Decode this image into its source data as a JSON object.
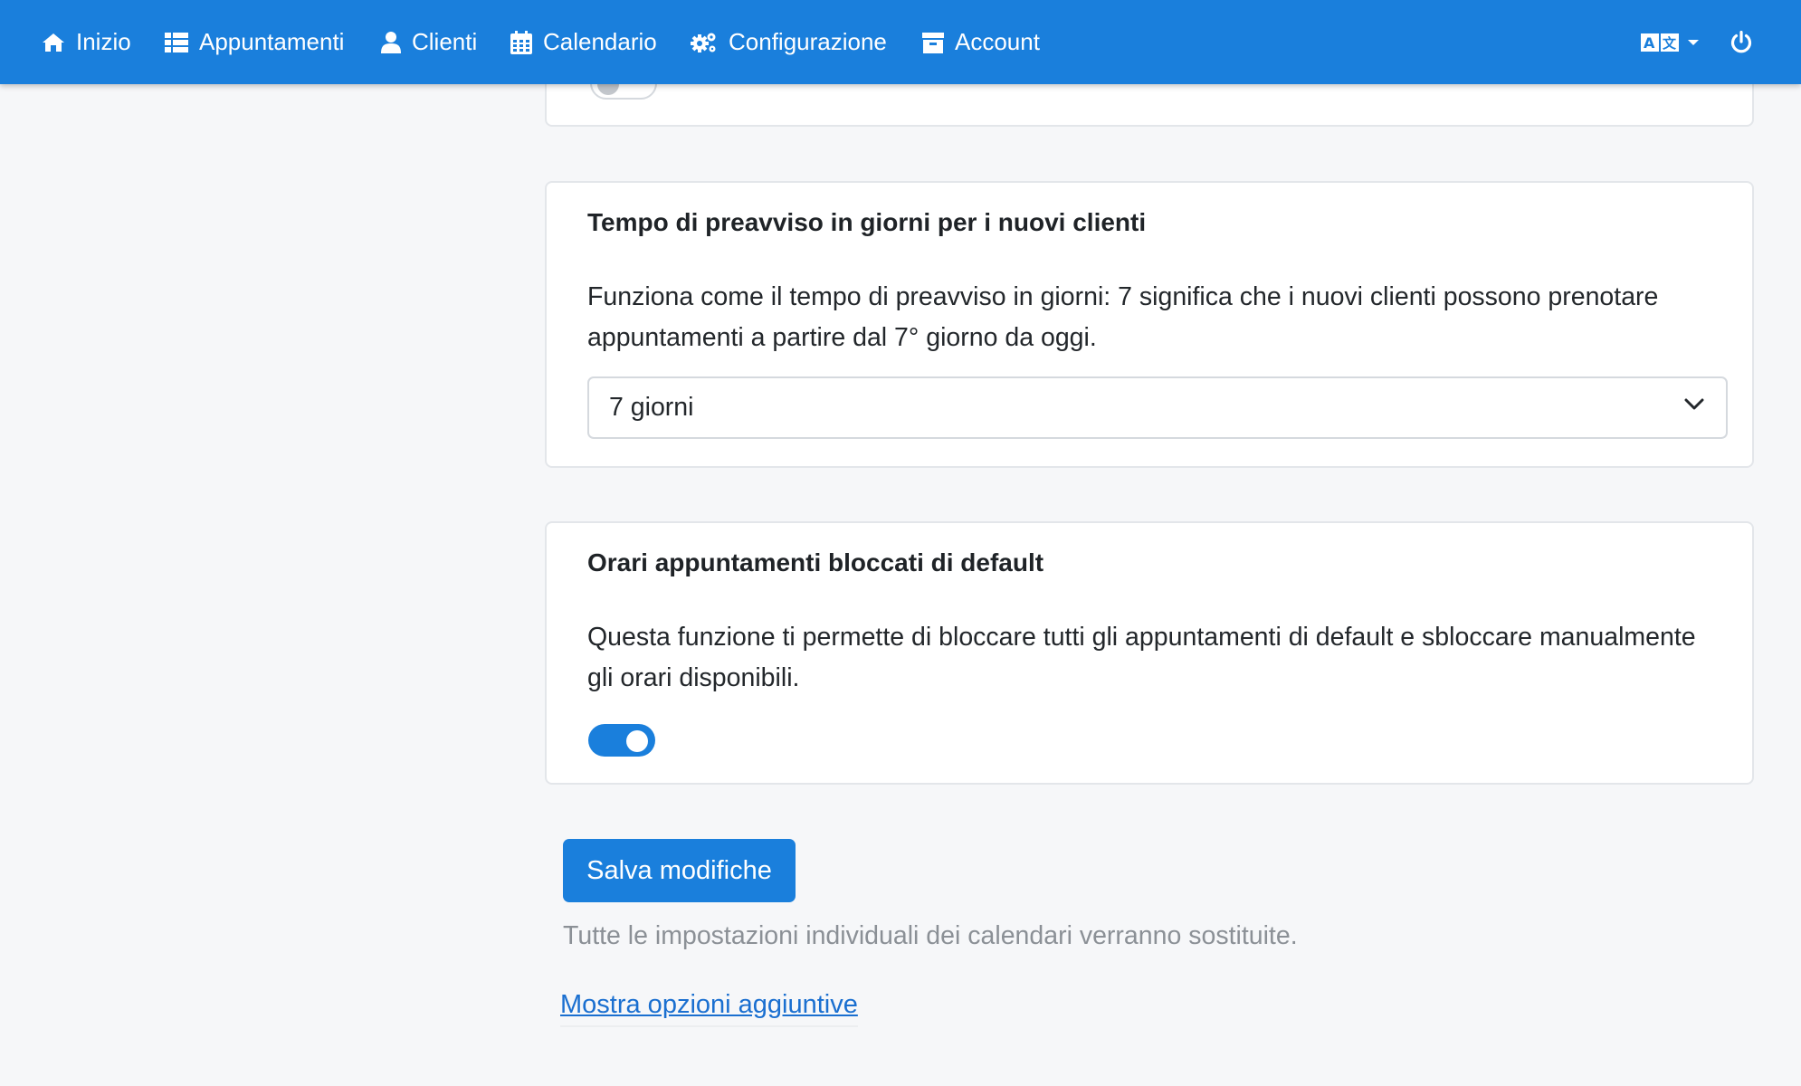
{
  "navbar": {
    "items": [
      {
        "label": "Inizio",
        "icon": "home-icon"
      },
      {
        "label": "Appuntamenti",
        "icon": "list-icon"
      },
      {
        "label": "Clienti",
        "icon": "user-icon"
      },
      {
        "label": "Calendario",
        "icon": "calendar-icon"
      },
      {
        "label": "Configurazione",
        "icon": "gears-icon"
      },
      {
        "label": "Account",
        "icon": "archive-icon"
      }
    ],
    "language_icon": "language-icon",
    "power_icon": "power-icon"
  },
  "cards": {
    "top_partial": {
      "toggle_state": "off"
    },
    "notice_new_clients": {
      "title": "Tempo di preavviso in giorni per i nuovi clienti",
      "description": "Funziona come il tempo di preavviso in giorni: 7 significa che i nuovi clienti possono prenotare appuntamenti a partire dal 7° giorno da oggi.",
      "select_value": "7 giorni"
    },
    "blocked_slots": {
      "title": "Orari appuntamenti bloccati di default",
      "description": "Questa funzione ti permette di bloccare tutti gli appuntamenti di default e sbloccare manualmente gli orari disponibili.",
      "toggle_state": "on"
    }
  },
  "actions": {
    "save_label": "Salva modifiche",
    "note": "Tutte le impostazioni individuali dei calendari verranno sostituite.",
    "more_options_link": "Mostra opzioni aggiuntive"
  },
  "colors": {
    "accent": "#1a7fdc",
    "background": "#f6f7f9",
    "link": "#1a6fd0",
    "muted_text": "#8b9096"
  }
}
